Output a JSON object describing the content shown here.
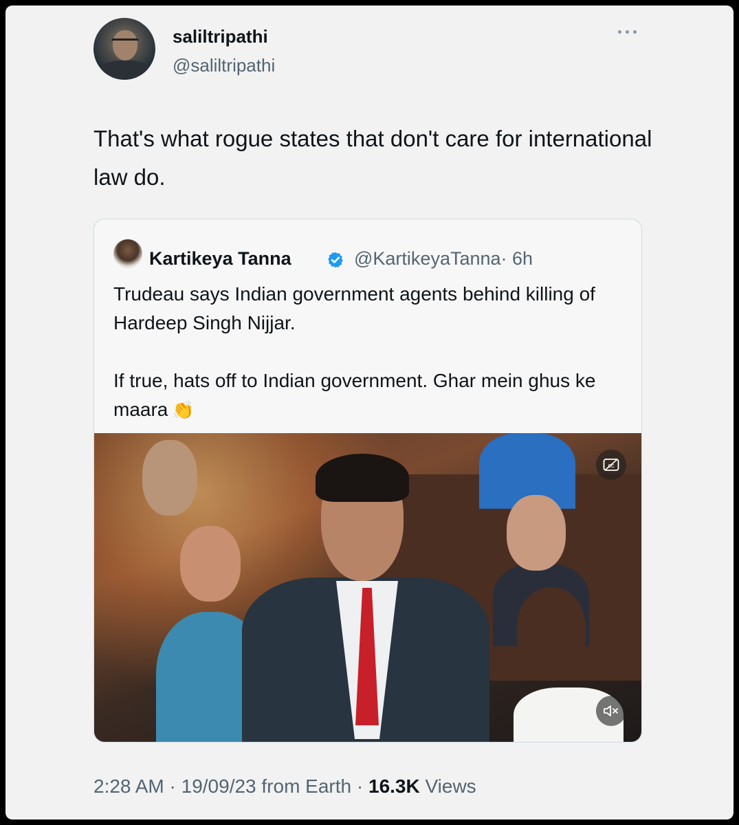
{
  "tweet": {
    "author": {
      "display_name": "saliltripathi",
      "handle": "@saliltripathi"
    },
    "more_icon": "more-horizontal-icon",
    "text": "That's what rogue states that don't care for international law do.",
    "meta": {
      "time": "2:28 AM",
      "sep1": " · ",
      "date": "19/09/23",
      "source": " from Earth",
      "sep2": " · ",
      "views_count": "16.3K",
      "views_label": " Views"
    }
  },
  "quote": {
    "author": {
      "display_name": "Kartikeya Tanna",
      "handle": "@KartikeyaTanna",
      "time": "· 6h",
      "verified_icon": "verified-badge-icon"
    },
    "text_p1": "Trudeau says Indian government agents behind killing of Hardeep Singh Nijjar.",
    "text_p2": "If true, hats off to Indian government. Ghar mein ghus ke maara",
    "emoji": "👏",
    "video": {
      "cc_icon": "closed-captions-icon",
      "mute_icon": "muted-speaker-icon"
    }
  },
  "colors": {
    "background": "#f2f2f2",
    "text_primary": "#0f1419",
    "text_secondary": "#536471",
    "verified_blue": "#1d9bf0",
    "border": "#cfd9de"
  }
}
